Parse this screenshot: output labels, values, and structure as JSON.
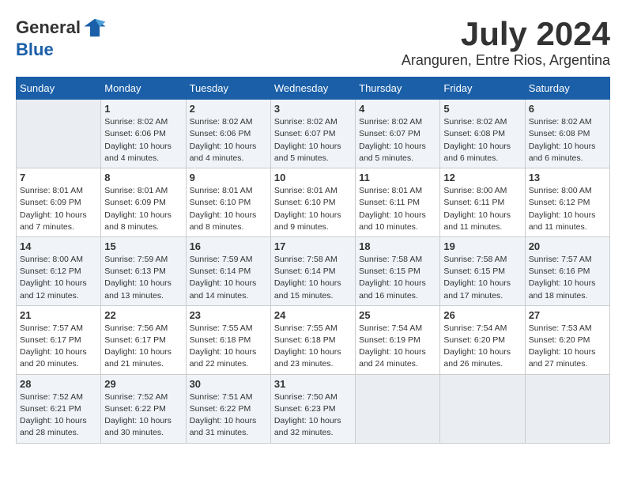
{
  "logo": {
    "general": "General",
    "blue": "Blue"
  },
  "title": {
    "month_year": "July 2024",
    "location": "Aranguren, Entre Rios, Argentina"
  },
  "days_of_week": [
    "Sunday",
    "Monday",
    "Tuesday",
    "Wednesday",
    "Thursday",
    "Friday",
    "Saturday"
  ],
  "weeks": [
    [
      {
        "day": "",
        "info": ""
      },
      {
        "day": "1",
        "info": "Sunrise: 8:02 AM\nSunset: 6:06 PM\nDaylight: 10 hours\nand 4 minutes."
      },
      {
        "day": "2",
        "info": "Sunrise: 8:02 AM\nSunset: 6:06 PM\nDaylight: 10 hours\nand 4 minutes."
      },
      {
        "day": "3",
        "info": "Sunrise: 8:02 AM\nSunset: 6:07 PM\nDaylight: 10 hours\nand 5 minutes."
      },
      {
        "day": "4",
        "info": "Sunrise: 8:02 AM\nSunset: 6:07 PM\nDaylight: 10 hours\nand 5 minutes."
      },
      {
        "day": "5",
        "info": "Sunrise: 8:02 AM\nSunset: 6:08 PM\nDaylight: 10 hours\nand 6 minutes."
      },
      {
        "day": "6",
        "info": "Sunrise: 8:02 AM\nSunset: 6:08 PM\nDaylight: 10 hours\nand 6 minutes."
      }
    ],
    [
      {
        "day": "7",
        "info": "Sunrise: 8:01 AM\nSunset: 6:09 PM\nDaylight: 10 hours\nand 7 minutes."
      },
      {
        "day": "8",
        "info": "Sunrise: 8:01 AM\nSunset: 6:09 PM\nDaylight: 10 hours\nand 8 minutes."
      },
      {
        "day": "9",
        "info": "Sunrise: 8:01 AM\nSunset: 6:10 PM\nDaylight: 10 hours\nand 8 minutes."
      },
      {
        "day": "10",
        "info": "Sunrise: 8:01 AM\nSunset: 6:10 PM\nDaylight: 10 hours\nand 9 minutes."
      },
      {
        "day": "11",
        "info": "Sunrise: 8:01 AM\nSunset: 6:11 PM\nDaylight: 10 hours\nand 10 minutes."
      },
      {
        "day": "12",
        "info": "Sunrise: 8:00 AM\nSunset: 6:11 PM\nDaylight: 10 hours\nand 11 minutes."
      },
      {
        "day": "13",
        "info": "Sunrise: 8:00 AM\nSunset: 6:12 PM\nDaylight: 10 hours\nand 11 minutes."
      }
    ],
    [
      {
        "day": "14",
        "info": "Sunrise: 8:00 AM\nSunset: 6:12 PM\nDaylight: 10 hours\nand 12 minutes."
      },
      {
        "day": "15",
        "info": "Sunrise: 7:59 AM\nSunset: 6:13 PM\nDaylight: 10 hours\nand 13 minutes."
      },
      {
        "day": "16",
        "info": "Sunrise: 7:59 AM\nSunset: 6:14 PM\nDaylight: 10 hours\nand 14 minutes."
      },
      {
        "day": "17",
        "info": "Sunrise: 7:58 AM\nSunset: 6:14 PM\nDaylight: 10 hours\nand 15 minutes."
      },
      {
        "day": "18",
        "info": "Sunrise: 7:58 AM\nSunset: 6:15 PM\nDaylight: 10 hours\nand 16 minutes."
      },
      {
        "day": "19",
        "info": "Sunrise: 7:58 AM\nSunset: 6:15 PM\nDaylight: 10 hours\nand 17 minutes."
      },
      {
        "day": "20",
        "info": "Sunrise: 7:57 AM\nSunset: 6:16 PM\nDaylight: 10 hours\nand 18 minutes."
      }
    ],
    [
      {
        "day": "21",
        "info": "Sunrise: 7:57 AM\nSunset: 6:17 PM\nDaylight: 10 hours\nand 20 minutes."
      },
      {
        "day": "22",
        "info": "Sunrise: 7:56 AM\nSunset: 6:17 PM\nDaylight: 10 hours\nand 21 minutes."
      },
      {
        "day": "23",
        "info": "Sunrise: 7:55 AM\nSunset: 6:18 PM\nDaylight: 10 hours\nand 22 minutes."
      },
      {
        "day": "24",
        "info": "Sunrise: 7:55 AM\nSunset: 6:18 PM\nDaylight: 10 hours\nand 23 minutes."
      },
      {
        "day": "25",
        "info": "Sunrise: 7:54 AM\nSunset: 6:19 PM\nDaylight: 10 hours\nand 24 minutes."
      },
      {
        "day": "26",
        "info": "Sunrise: 7:54 AM\nSunset: 6:20 PM\nDaylight: 10 hours\nand 26 minutes."
      },
      {
        "day": "27",
        "info": "Sunrise: 7:53 AM\nSunset: 6:20 PM\nDaylight: 10 hours\nand 27 minutes."
      }
    ],
    [
      {
        "day": "28",
        "info": "Sunrise: 7:52 AM\nSunset: 6:21 PM\nDaylight: 10 hours\nand 28 minutes."
      },
      {
        "day": "29",
        "info": "Sunrise: 7:52 AM\nSunset: 6:22 PM\nDaylight: 10 hours\nand 30 minutes."
      },
      {
        "day": "30",
        "info": "Sunrise: 7:51 AM\nSunset: 6:22 PM\nDaylight: 10 hours\nand 31 minutes."
      },
      {
        "day": "31",
        "info": "Sunrise: 7:50 AM\nSunset: 6:23 PM\nDaylight: 10 hours\nand 32 minutes."
      },
      {
        "day": "",
        "info": ""
      },
      {
        "day": "",
        "info": ""
      },
      {
        "day": "",
        "info": ""
      }
    ]
  ]
}
